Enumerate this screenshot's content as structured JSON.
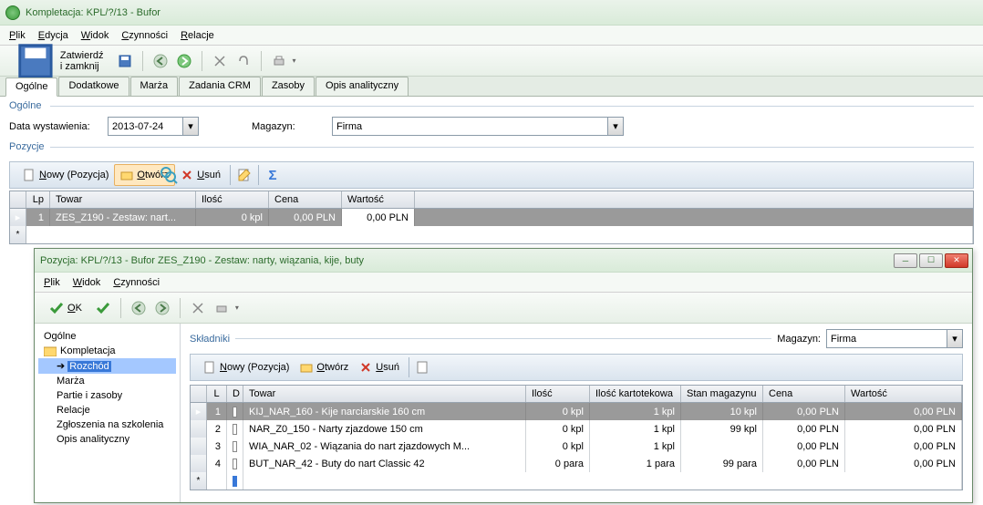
{
  "main": {
    "title": "Kompletacja: KPL/?/13 - Bufor",
    "menu": [
      "Plik",
      "Edycja",
      "Widok",
      "Czynności",
      "Relacje"
    ],
    "confirmClose": "Zatwierdź i zamknij",
    "tabs": [
      "Ogólne",
      "Dodatkowe",
      "Marża",
      "Zadania CRM",
      "Zasoby",
      "Opis analityczny"
    ],
    "section1": "Ogólne",
    "section2": "Pozycje",
    "dateLabel": "Data wystawienia:",
    "dateValue": "2013-07-24",
    "magLabel": "Magazyn:",
    "magValue": "Firma",
    "posButtons": {
      "new": "Nowy (Pozycja)",
      "open": "Otwórz",
      "del": "Usuń"
    },
    "gridHeaders": {
      "lp": "Lp",
      "towar": "Towar",
      "ilosc": "Ilość",
      "cena": "Cena",
      "wartosc": "Wartość"
    },
    "gridRow": {
      "lp": "1",
      "towar": "ZES_Z190 - Zestaw: nart...",
      "ilosc": "0 kpl",
      "cena": "0,00 PLN",
      "wartosc": "0,00 PLN"
    }
  },
  "child": {
    "title": "Pozycja: KPL/?/13 - Bufor ZES_Z190 - Zestaw: narty, wiązania, kije, buty",
    "menu": [
      "Plik",
      "Widok",
      "Czynności"
    ],
    "ok": "OK",
    "tree": {
      "root": "Ogólne",
      "folder": "Kompletacja",
      "items": [
        "Rozchód",
        "Marża",
        "Partie i zasoby",
        "Relacje",
        "Zgłoszenia na szkolenia",
        "Opis analityczny"
      ]
    },
    "sectionLabel": "Składniki",
    "magLabel": "Magazyn:",
    "magValue": "Firma",
    "posButtons": {
      "new": "Nowy (Pozycja)",
      "open": "Otwórz",
      "del": "Usuń"
    },
    "headers": {
      "l": "L",
      "d": "D",
      "towar": "Towar",
      "ilosc": "Ilość",
      "iloscK": "Ilość kartotekowa",
      "stan": "Stan magazynu",
      "cena": "Cena",
      "wartosc": "Wartość"
    },
    "rows": [
      {
        "l": "1",
        "towar": "KIJ_NAR_160 - Kije narciarskie 160 cm",
        "ilosc": "0 kpl",
        "iloscK": "1 kpl",
        "stan": "10 kpl",
        "cena": "0,00 PLN",
        "wartosc": "0,00 PLN"
      },
      {
        "l": "2",
        "towar": "NAR_Z0_150 - Narty zjazdowe 150 cm",
        "ilosc": "0 kpl",
        "iloscK": "1 kpl",
        "stan": "99 kpl",
        "cena": "0,00 PLN",
        "wartosc": "0,00 PLN"
      },
      {
        "l": "3",
        "towar": "WIA_NAR_02 - Wiązania do nart zjazdowych M...",
        "ilosc": "0 kpl",
        "iloscK": "1 kpl",
        "stan": "",
        "cena": "0,00 PLN",
        "wartosc": "0,00 PLN"
      },
      {
        "l": "4",
        "towar": "BUT_NAR_42 - Buty do nart Classic 42",
        "ilosc": "0 para",
        "iloscK": "1 para",
        "stan": "99 para",
        "cena": "0,00 PLN",
        "wartosc": "0,00 PLN"
      }
    ]
  }
}
